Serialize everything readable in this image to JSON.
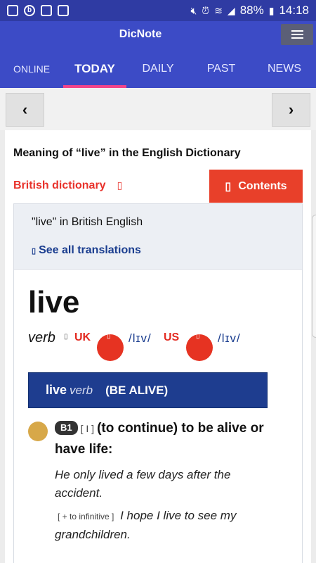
{
  "status_bar": {
    "battery": "88%",
    "time": "14:18"
  },
  "app": {
    "title": "DicNote",
    "tabs": [
      {
        "label": "ONLINE"
      },
      {
        "label": "TODAY"
      },
      {
        "label": "DAILY"
      },
      {
        "label": "PAST"
      },
      {
        "label": "NEWS"
      }
    ],
    "active_tab": "TODAY"
  },
  "nav": {
    "prev_glyph": "‹",
    "next_glyph": "›"
  },
  "page": {
    "meaning_title": "Meaning of “live” in the English Dictionary",
    "british_label": "British dictionary",
    "british_glyph": "▯",
    "contents_label": "Contents",
    "contents_glyph": "▯",
    "translation": {
      "title": "\"live\" in British English",
      "link_label": "See all translations",
      "link_glyph": "▯"
    },
    "entry": {
      "headword": "live",
      "pos": "verb",
      "pos_glyph": "▯",
      "uk_label": "UK",
      "uk_audio_glyph": "▯",
      "uk_ipa": "/lɪv/",
      "us_label": "US",
      "us_audio_glyph": "▯",
      "us_ipa": "/lɪv/",
      "sense_headword": "live",
      "sense_pos": "verb",
      "sense_guideword": "(BE ALIVE)",
      "level": "B1",
      "grammar": "[ I ]",
      "definition": "(to continue) to be alive or have life:",
      "examples": [
        {
          "grammar": "",
          "text": "He only lived a few days after the accident."
        },
        {
          "grammar": "[ + to infinitive ]",
          "text": "I hope I live to see my grandchildren."
        }
      ]
    }
  },
  "colors": {
    "status_bar": "#2f3ba3",
    "app_bar": "#3c4bc6",
    "tab_indicator": "#f2458a",
    "accent_red": "#e8402a",
    "sense_bar": "#1e3d8f",
    "level_circle": "#d7a849"
  }
}
